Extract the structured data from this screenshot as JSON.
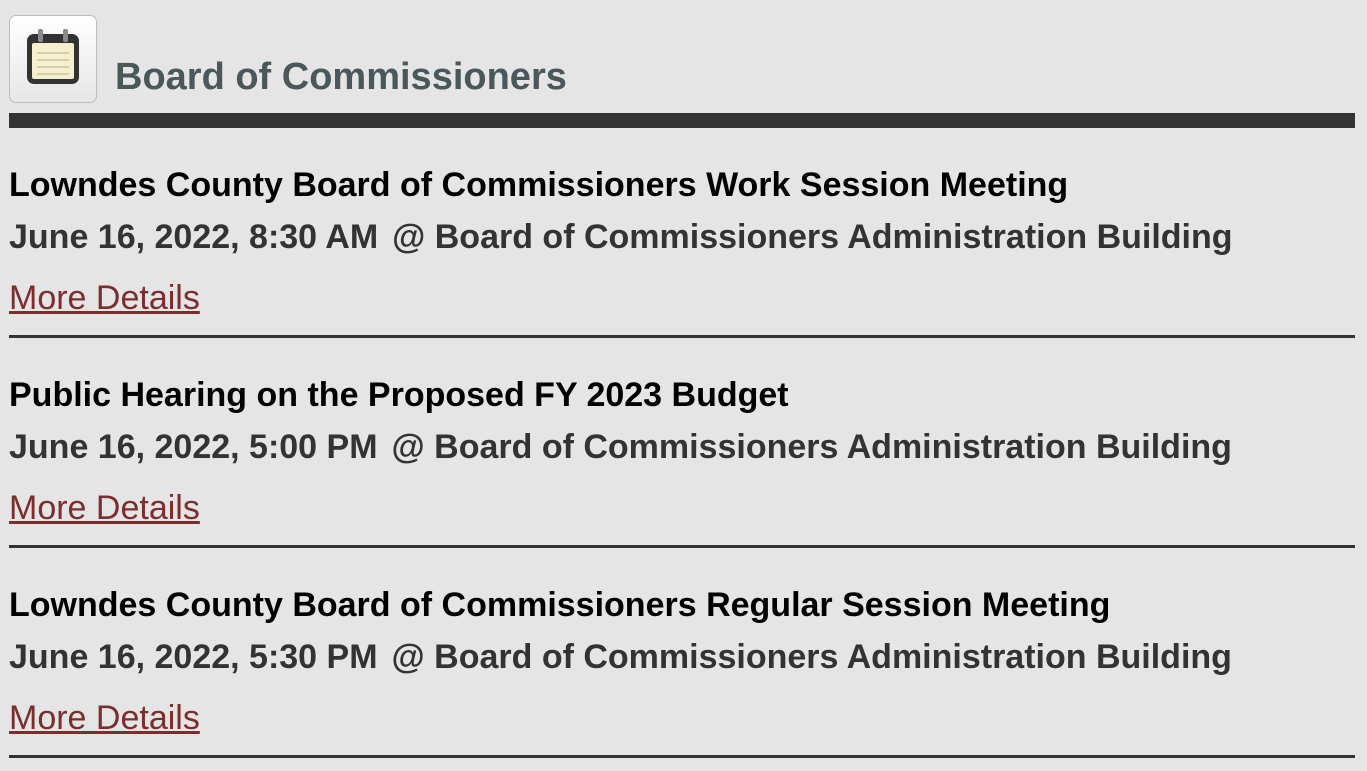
{
  "header": {
    "icon": "calendar-icon",
    "title": "Board of Commissioners"
  },
  "events": [
    {
      "title": "Lowndes County Board of Commissioners Work Session Meeting",
      "date": "June 16, 2022, 8:30 AM",
      "location": "@ Board of Commissioners Administration Building",
      "link_label": "More Details"
    },
    {
      "title": "Public Hearing on the Proposed FY 2023 Budget",
      "date": "June 16, 2022, 5:00 PM",
      "location": "@ Board of Commissioners Administration Building",
      "link_label": "More Details"
    },
    {
      "title": "Lowndes County Board of Commissioners Regular Session Meeting",
      "date": "June 16, 2022, 5:30 PM",
      "location": "@ Board of Commissioners Administration Building",
      "link_label": "More Details"
    }
  ],
  "colors": {
    "background": "#e5e5e5",
    "header_title": "#4a585c",
    "divider": "#333333",
    "link": "#7c2d2d"
  }
}
